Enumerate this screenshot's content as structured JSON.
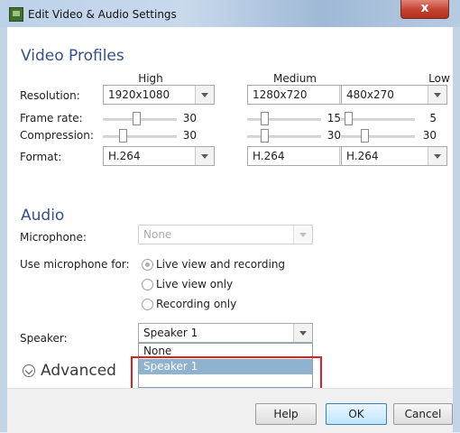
{
  "window": {
    "title": "Edit Video & Audio Settings",
    "close_glyph": "x"
  },
  "video": {
    "section_title": "Video Profiles",
    "columns": [
      "High",
      "Medium",
      "Low"
    ],
    "labels": {
      "resolution": "Resolution:",
      "frame_rate": "Frame rate:",
      "compression": "Compression:",
      "format": "Format:"
    },
    "profiles": [
      {
        "resolution": "1920x1080",
        "frame_rate": "30",
        "frame_rate_fraction": 0.45,
        "compression": "30",
        "compression_fraction": 0.25,
        "format": "H.264"
      },
      {
        "resolution": "1280x720",
        "frame_rate": "15",
        "frame_rate_fraction": 0.2,
        "compression": "30",
        "compression_fraction": 0.2,
        "format": "H.264"
      },
      {
        "resolution": "480x270",
        "frame_rate": "5",
        "frame_rate_fraction": 0.05,
        "compression": "30",
        "compression_fraction": 0.3,
        "format": "H.264"
      }
    ]
  },
  "audio": {
    "section_title": "Audio",
    "microphone_label": "Microphone:",
    "microphone_value": "None",
    "use_for_label": "Use microphone for:",
    "use_for_options": [
      "Live view and recording",
      "Live view only",
      "Recording only"
    ],
    "use_for_selected": 0,
    "speaker_label": "Speaker:",
    "speaker_value": "Speaker 1",
    "speaker_options": [
      "None",
      "Speaker 1"
    ],
    "speaker_highlighted": 1
  },
  "advanced_label": "Advanced",
  "footer": {
    "help": "Help",
    "ok": "OK",
    "cancel": "Cancel"
  }
}
